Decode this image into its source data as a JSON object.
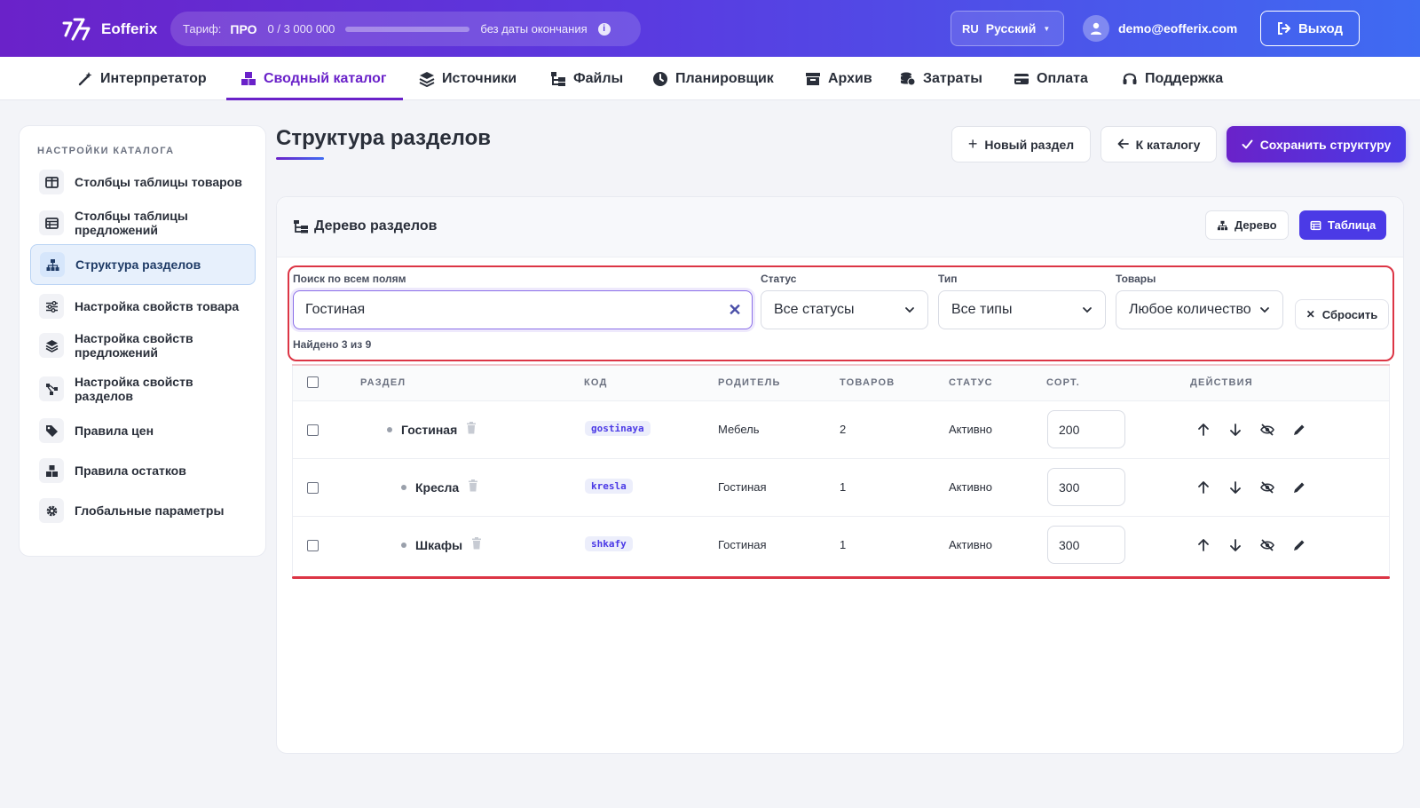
{
  "app": {
    "name": "Eofferix"
  },
  "plan": {
    "label": "Тариф:",
    "name": "ПРО",
    "usage": "0 / 3 000 000",
    "usage_fraction": 0,
    "no_end": "без даты окончания"
  },
  "lang": {
    "code": "RU",
    "name": "Русский"
  },
  "user": {
    "email": "demo@eofferix.com"
  },
  "logout_label": "Выход",
  "nav": [
    {
      "label": "Интерпретатор",
      "icon": "magic-wand-icon"
    },
    {
      "label": "Сводный каталог",
      "icon": "cubes-icon",
      "active": true
    },
    {
      "label": "Источники",
      "icon": "layers-icon"
    },
    {
      "label": "Файлы",
      "icon": "folder-tree-icon"
    },
    {
      "label": "Планировщик",
      "icon": "clock-icon"
    },
    {
      "label": "Архив",
      "icon": "archive-icon"
    },
    {
      "label": "Затраты",
      "icon": "coins-icon"
    },
    {
      "label": "Оплата",
      "icon": "credit-card-icon"
    },
    {
      "label": "Поддержка",
      "icon": "headset-icon"
    }
  ],
  "sidebar": {
    "title": "НАСТРОЙКИ КАТАЛОГА",
    "items": [
      {
        "label": "Столбцы таблицы товаров",
        "icon": "columns-icon"
      },
      {
        "label": "Столбцы таблицы предложений",
        "icon": "table-list-icon"
      },
      {
        "label": "Структура разделов",
        "icon": "sitemap-icon",
        "active": true
      },
      {
        "label": "Настройка свойств товара",
        "icon": "sliders-icon"
      },
      {
        "label": "Настройка свойств предложений",
        "icon": "layers-icon"
      },
      {
        "label": "Настройка свойств разделов",
        "icon": "diagram-icon"
      },
      {
        "label": "Правила цен",
        "icon": "tags-icon"
      },
      {
        "label": "Правила остатков",
        "icon": "boxes-icon"
      },
      {
        "label": "Глобальные параметры",
        "icon": "gear-icon"
      }
    ]
  },
  "page": {
    "title": "Структура разделов",
    "new_section": "Новый раздел",
    "to_catalog": "К каталогу",
    "save": "Сохранить структуру"
  },
  "card": {
    "title": "Дерево разделов",
    "view_tree": "Дерево",
    "view_table": "Таблица"
  },
  "filters": {
    "search_label": "Поиск по всем полям",
    "search_value": "Гостиная",
    "status_label": "Статус",
    "status_value": "Все статусы",
    "type_label": "Тип",
    "type_value": "Все типы",
    "goods_label": "Товары",
    "goods_value": "Любое количество",
    "reset": "Сбросить",
    "found": "Найдено 3 из 9"
  },
  "table": {
    "headers": {
      "section": "РАЗДЕЛ",
      "code": "КОД",
      "parent": "РОДИТЕЛЬ",
      "goods": "ТОВАРОВ",
      "status": "СТАТУС",
      "sort": "СОРТ.",
      "actions": "ДЕЙСТВИЯ"
    },
    "rows": [
      {
        "name": "Гостиная",
        "code": "gostinaya",
        "parent": "Мебель",
        "goods": "2",
        "status": "Активно",
        "sort": "200"
      },
      {
        "name": "Кресла",
        "code": "kresla",
        "parent": "Гостиная",
        "goods": "1",
        "status": "Активно",
        "sort": "300"
      },
      {
        "name": "Шкафы",
        "code": "shkafy",
        "parent": "Гостиная",
        "goods": "1",
        "status": "Активно",
        "sort": "300"
      }
    ]
  },
  "colors": {
    "brand": "#6a22c9",
    "accent": "#4b3ae6",
    "highlight": "#dc3545"
  }
}
